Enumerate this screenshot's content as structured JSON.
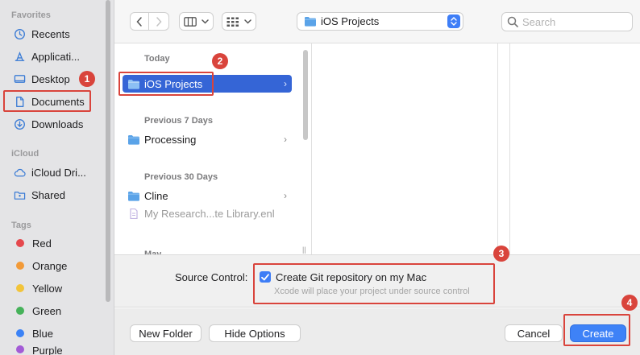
{
  "sidebar": {
    "sections": {
      "favorites": "Favorites",
      "icloud": "iCloud",
      "tags": "Tags"
    },
    "favorites": [
      {
        "label": "Recents",
        "icon": "clock-icon"
      },
      {
        "label": "Applicati...",
        "icon": "applications-icon"
      },
      {
        "label": "Desktop",
        "icon": "desktop-icon"
      },
      {
        "label": "Documents",
        "icon": "document-icon"
      },
      {
        "label": "Downloads",
        "icon": "downloads-icon"
      }
    ],
    "icloud": [
      {
        "label": "iCloud Dri...",
        "icon": "cloud-icon"
      },
      {
        "label": "Shared",
        "icon": "shared-folder-icon"
      }
    ],
    "tags": [
      {
        "label": "Red",
        "color": "#e5484d"
      },
      {
        "label": "Orange",
        "color": "#f29a38"
      },
      {
        "label": "Yellow",
        "color": "#f2c43a"
      },
      {
        "label": "Green",
        "color": "#46b25a"
      },
      {
        "label": "Blue",
        "color": "#3b82f6"
      },
      {
        "label": "Purple",
        "color": "#a35bd6"
      }
    ]
  },
  "toolbar": {
    "back_icon": "chevron-left-icon",
    "forward_icon": "chevron-right-icon",
    "view_icon": "column-view-icon",
    "group_icon": "grid-icon",
    "path": "iOS Projects",
    "search_placeholder": "Search"
  },
  "browser": {
    "groups": {
      "today": "Today",
      "prev7": "Previous 7 Days",
      "prev30": "Previous 30 Days",
      "may": "May"
    },
    "items": [
      {
        "label": "iOS Projects"
      },
      {
        "label": "Processing"
      },
      {
        "label": "Cline"
      },
      {
        "label": "My Research...te Library.enl"
      }
    ]
  },
  "source_control": {
    "label": "Source Control:",
    "checkbox_label": "Create Git repository on my Mac",
    "help": "Xcode will place your project under source control"
  },
  "buttons": {
    "new_folder": "New Folder",
    "hide_options": "Hide Options",
    "cancel": "Cancel",
    "create": "Create"
  },
  "annotations": [
    "1",
    "2",
    "3",
    "4"
  ],
  "colors": {
    "accent": "#3565d6",
    "annotation": "#d9443c"
  }
}
